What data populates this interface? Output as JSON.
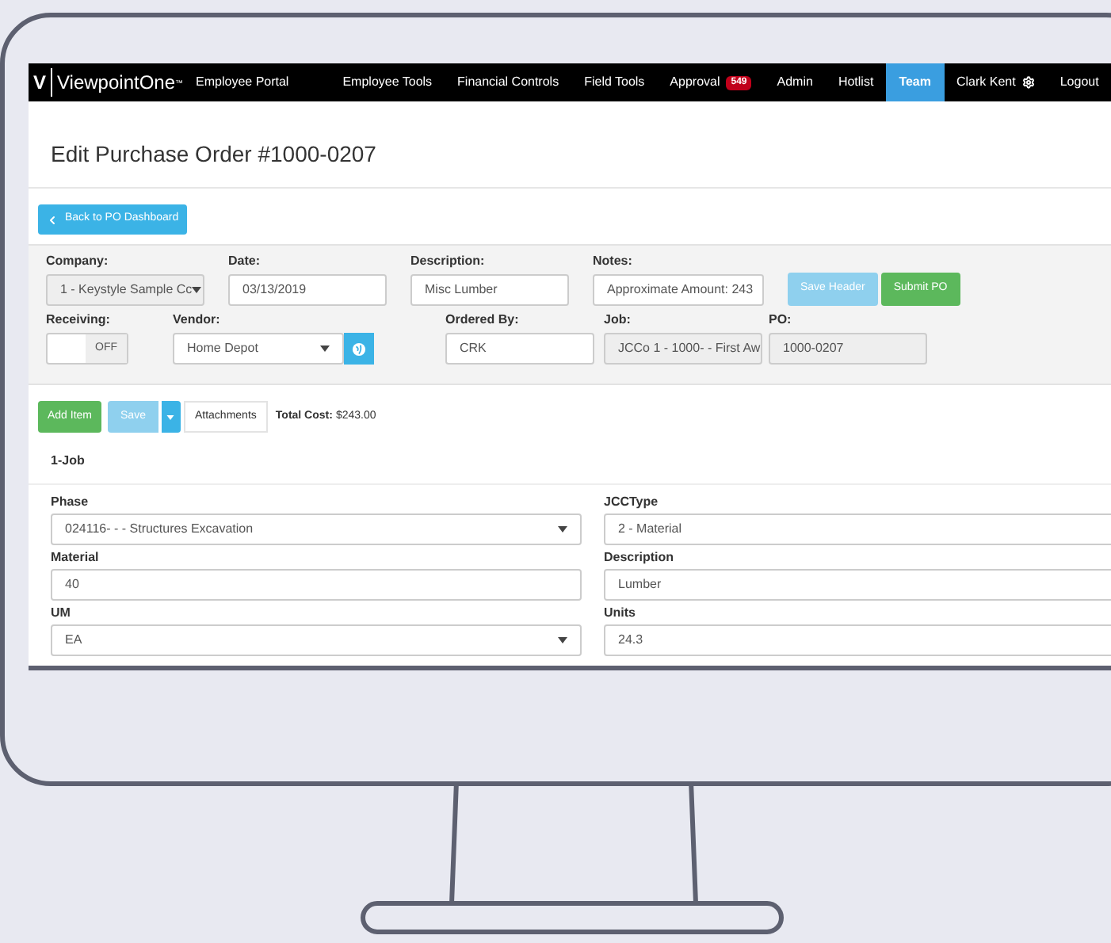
{
  "nav": {
    "logo": "V",
    "brand": "ViewpointOne",
    "brand_mark": "™",
    "portal": "Employee Portal",
    "items": [
      {
        "label": "Employee Tools",
        "selected": false
      },
      {
        "label": "Financial Controls",
        "selected": false
      },
      {
        "label": "Field Tools",
        "selected": false
      },
      {
        "label": "Approval",
        "badge": "549",
        "selected": false
      },
      {
        "label": "Admin",
        "selected": false
      },
      {
        "label": "Hotlist",
        "selected": false
      },
      {
        "label": "Team",
        "selected": true
      },
      {
        "label": "Clark Kent",
        "selected": false
      },
      {
        "label": "Logout",
        "selected": false
      }
    ]
  },
  "title": "Edit Purchase Order #1000-0207",
  "back_button": "Back to PO Dashboard",
  "header": {
    "row1": [
      {
        "label": "Company:",
        "value": "1 - Keystyle Sample Cc",
        "kind": "select",
        "disabled": true
      },
      {
        "label": "Date:",
        "value": "03/13/2019",
        "kind": "text",
        "disabled": false
      },
      {
        "label": "Description:",
        "value": "Misc Lumber",
        "kind": "text",
        "disabled": false
      },
      {
        "label": "Notes:",
        "value": "Approximate Amount: 243",
        "kind": "text",
        "disabled": false
      }
    ],
    "save_header": {
      "label": "Save Header",
      "disabled": true
    },
    "submit": {
      "label": "Submit PO",
      "disabled": false
    },
    "receiving": {
      "label": "Receiving:",
      "state": "OFF",
      "on": false
    },
    "vendor": {
      "label": "Vendor:",
      "value": "Home Depot"
    },
    "row2": [
      {
        "label": "Ordered By:",
        "value": "CRK",
        "disabled": false
      },
      {
        "label": "Job:",
        "value": "JCCo 1 -   1000- - First Aw",
        "disabled": true
      },
      {
        "label": "PO:",
        "value": "1000-0207",
        "disabled": true
      }
    ]
  },
  "toolbar": {
    "add_item": "Add Item",
    "save": {
      "label": "Save",
      "disabled": true
    },
    "attachments": "Attachments",
    "total_label": "Total Cost:",
    "total_value": "$243.00"
  },
  "item": {
    "heading": "1-Job",
    "fields": [
      {
        "label": "Phase",
        "value": "024116- - - Structures Excavation",
        "kind": "select"
      },
      {
        "label": "JCCType",
        "value": "2 - Material",
        "kind": "select"
      },
      {
        "label": "Material",
        "value": "40",
        "kind": "text"
      },
      {
        "label": "Description",
        "value": "Lumber",
        "kind": "text"
      },
      {
        "label": "UM",
        "value": "EA",
        "kind": "select"
      },
      {
        "label": "Units",
        "value": "24.3",
        "kind": "text"
      }
    ]
  }
}
